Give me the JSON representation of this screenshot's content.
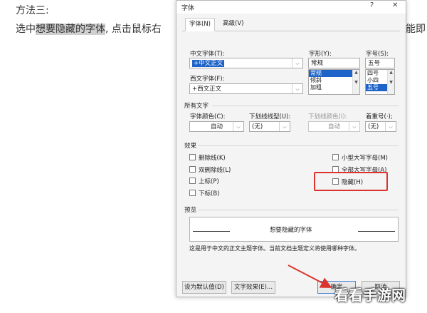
{
  "document": {
    "line1": "方法三:",
    "line2_before": "选中",
    "line2_highlight": "想要隐藏的字体",
    "line2_after": ", 点击鼠标右",
    "line2_right": "能即"
  },
  "dialog": {
    "title": "字体",
    "help_button": "?",
    "close_button": "✕",
    "tabs": [
      {
        "label": "字体(N)",
        "active": true
      },
      {
        "label": "高级(V)",
        "active": false
      }
    ],
    "chinese_font_label": "中文字体(T):",
    "chinese_font_value": "+中文正文",
    "western_font_label": "西文字体(F):",
    "western_font_value": "+西文正文",
    "style_label": "字形(Y):",
    "style_value": "常规",
    "style_options": [
      "常规",
      "倾斜",
      "加粗"
    ],
    "size_label": "字号(S):",
    "size_value": "五号",
    "size_options": [
      "四号",
      "小四",
      "五号"
    ],
    "all_text_section": "所有文字",
    "font_color_label": "字体颜色(C):",
    "font_color_value": "自动",
    "underline_style_label": "下划线线型(U):",
    "underline_style_value": "(无)",
    "underline_color_label": "下划线颜色(I):",
    "underline_color_value": "自动",
    "emphasis_label": "着重号(·);",
    "emphasis_value": "(无)",
    "effects_section": "效果",
    "effects_left": [
      "删除线(K)",
      "双删除线(L)",
      "上标(P)",
      "下标(B)"
    ],
    "effects_right": [
      "小型大写字母(M)",
      "全部大写字母(A)",
      "隐藏(H)"
    ],
    "preview_section": "预览",
    "preview_text": "想要隐藏的字体",
    "preview_note": "这是用于中文的正文主题字体。当前文档主题定义将使用哪种字体。",
    "set_default_button": "设为默认值(D)",
    "text_effects_button": "文字效果(E)...",
    "ok_button": "确定",
    "cancel_button": "取消"
  },
  "watermark": "看看手游网",
  "colors": {
    "highlight_box": "#d9352e",
    "selection": "#1e63c8"
  }
}
